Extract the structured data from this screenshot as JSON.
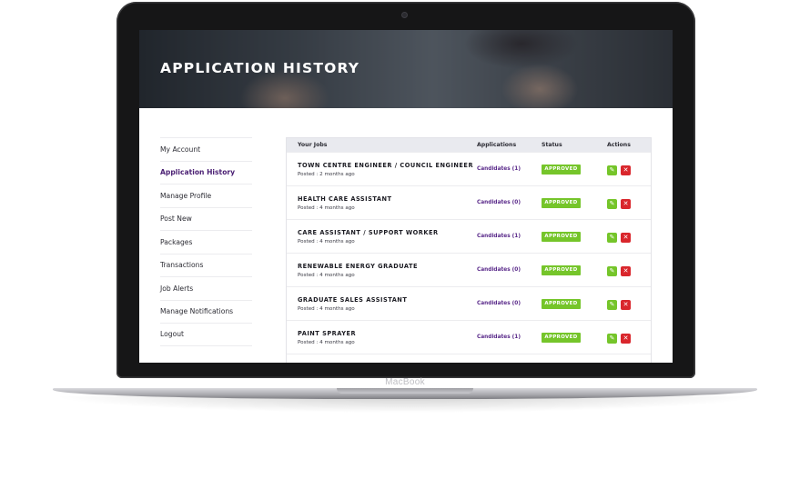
{
  "device": {
    "brand_label": "MacBook"
  },
  "header": {
    "title": "APPLICATION HISTORY"
  },
  "sidebar": {
    "items": [
      {
        "label": "My Account"
      },
      {
        "label": "Application History"
      },
      {
        "label": "Manage Profile"
      },
      {
        "label": "Post New"
      },
      {
        "label": "Packages"
      },
      {
        "label": "Transactions"
      },
      {
        "label": "Job Alerts"
      },
      {
        "label": "Manage Notifications"
      },
      {
        "label": "Logout"
      }
    ],
    "active_index": 1
  },
  "table": {
    "headers": {
      "job": "Your Jobs",
      "applications": "Applications",
      "status": "Status",
      "actions": "Actions"
    },
    "rows": [
      {
        "title": "TOWN CENTRE ENGINEER / COUNCIL ENGINEER",
        "posted": "Posted : 2 months ago",
        "candidates": "Candidates (1)",
        "status": "APPROVED"
      },
      {
        "title": "HEALTH CARE ASSISTANT",
        "posted": "Posted : 4 months ago",
        "candidates": "Candidates (0)",
        "status": "APPROVED"
      },
      {
        "title": "CARE ASSISTANT / SUPPORT WORKER",
        "posted": "Posted : 4 months ago",
        "candidates": "Candidates (1)",
        "status": "APPROVED"
      },
      {
        "title": "RENEWABLE ENERGY GRADUATE",
        "posted": "Posted : 4 months ago",
        "candidates": "Candidates (0)",
        "status": "APPROVED"
      },
      {
        "title": "GRADUATE SALES ASSISTANT",
        "posted": "Posted : 4 months ago",
        "candidates": "Candidates (0)",
        "status": "APPROVED"
      },
      {
        "title": "PAINT SPRAYER",
        "posted": "Posted : 4 months ago",
        "candidates": "Candidates (1)",
        "status": "APPROVED"
      }
    ]
  },
  "icons": {
    "edit": "pencil-icon",
    "delete": "close-icon"
  },
  "colors": {
    "accent": "#4a1f73",
    "approved": "#75c52a",
    "delete": "#d9262c"
  }
}
